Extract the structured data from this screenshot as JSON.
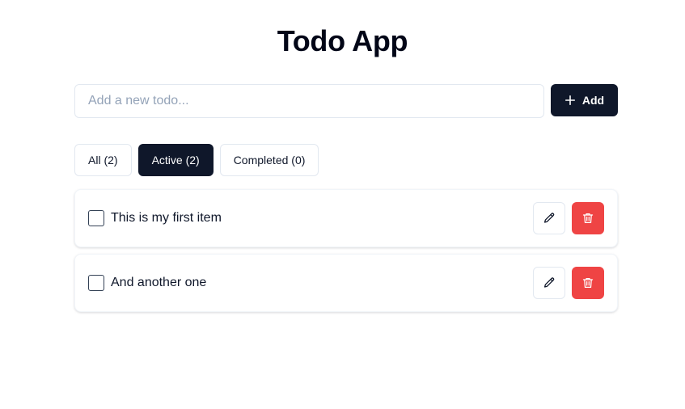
{
  "app": {
    "title": "Todo App"
  },
  "add_form": {
    "placeholder": "Add a new todo...",
    "value": "",
    "add_label": "Add",
    "add_icon": "plus-icon"
  },
  "filters": [
    {
      "label": "All (2)",
      "active": false
    },
    {
      "label": "Active (2)",
      "active": true
    },
    {
      "label": "Completed (0)",
      "active": false
    }
  ],
  "todos": [
    {
      "text": "This is my first item",
      "completed": false
    },
    {
      "text": "And another one",
      "completed": false
    }
  ],
  "item_actions": {
    "edit_icon": "pencil-icon",
    "delete_icon": "trash-icon"
  },
  "colors": {
    "primary": "#0f172a",
    "danger": "#ef4444",
    "border": "#e2e8f0",
    "placeholder": "#94a3b8"
  }
}
